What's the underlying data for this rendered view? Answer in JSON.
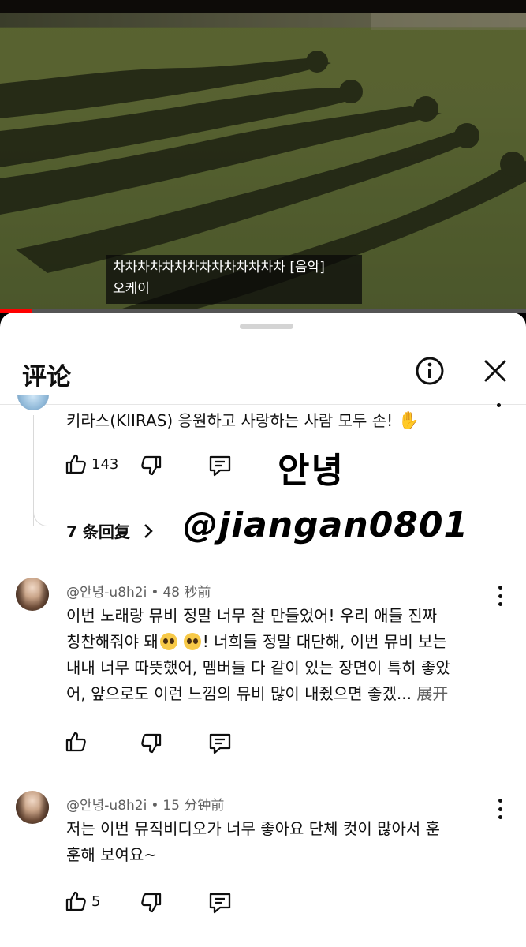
{
  "video": {
    "subtitle_line1": "차차차차차차차차차차차차차차 [음악]",
    "subtitle_line2": "오케이",
    "progress": 0.06
  },
  "sheet": {
    "title": "评论",
    "info_icon": "info-icon",
    "close_icon": "close-icon"
  },
  "comments": [
    {
      "text": "키라스(KIIRAS) 응원하고 사랑하는 사람 모두 손!",
      "emoji": "✋",
      "likes": "143",
      "replies_label": "7 条回复"
    },
    {
      "author": "@안녕-u8h2i",
      "time": "48 秒前",
      "line1": "이번 노래랑 뮤비 정말 너무 잘 만들었어! 우리 애들 진짜",
      "line2a": "칭찬해줘야 돼",
      "line2b": "! 너희들 정말 대단해, 이번 뮤비 보는",
      "line3": "내내 너무 따뜻했어, 멤버들 다 같이 있는 장면이 특히 좋았",
      "line4": "어, 앞으로도 이런 느낌의 뮤비 많이 내줬으면 좋겠...",
      "expand": "展开",
      "likes": ""
    },
    {
      "author": "@안녕-u8h2i",
      "time": "15 分钟前",
      "line1": "저는 이번 뮤직비디오가 너무 좋아요 단체 컷이 많아서 훈",
      "line2": "훈해 보여요~",
      "likes": "5"
    }
  ],
  "watermark": {
    "line1": "안녕",
    "line2": "@jiangan0801"
  }
}
